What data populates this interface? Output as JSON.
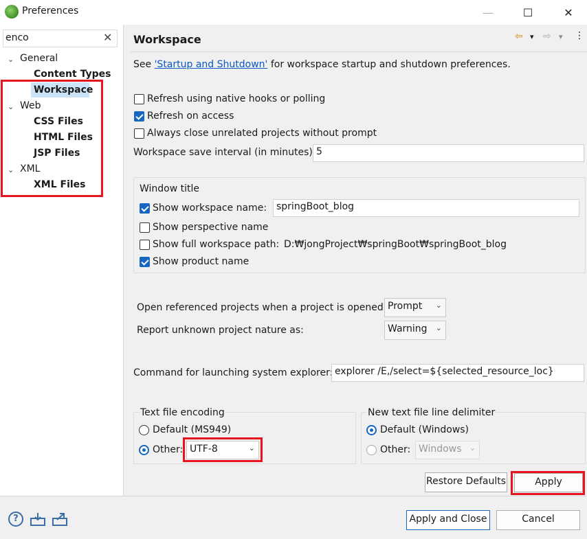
{
  "window": {
    "title": "Preferences",
    "minimize": "—",
    "maximize": "☐",
    "close": "✕"
  },
  "filter": {
    "value": "enco",
    "clear": "✕"
  },
  "tree": [
    {
      "label": "General",
      "chev": "⌄"
    },
    {
      "label": "Content Types"
    },
    {
      "label": "Workspace"
    },
    {
      "label": "Web",
      "chev": "⌄"
    },
    {
      "label": "CSS Files"
    },
    {
      "label": "HTML Files"
    },
    {
      "label": "JSP Files"
    },
    {
      "label": "XML",
      "chev": "⌄"
    },
    {
      "label": "XML Files"
    }
  ],
  "page": {
    "title": "Workspace",
    "nav": {
      "back": "⇦",
      "back_menu": "▾",
      "forward": "⇨",
      "forward_menu": "▾",
      "more": "⋮"
    },
    "intro_prefix": "See ",
    "intro_link": "'Startup and Shutdown'",
    "intro_suffix": " for workspace startup and shutdown preferences.",
    "checkboxes": [
      {
        "label": "Refresh using native hooks or polling",
        "checked": false
      },
      {
        "label": "Refresh on access",
        "checked": true
      },
      {
        "label": "Always close unrelated projects without prompt",
        "checked": false
      }
    ],
    "save_interval": {
      "label": "Workspace save interval (in minutes):",
      "value": "5"
    },
    "window_title": {
      "legend": "Window title",
      "show_workspace_name": {
        "label": "Show workspace name:",
        "checked": true,
        "value": "springBoot_blog"
      },
      "show_perspective_name": {
        "label": "Show perspective name",
        "checked": false
      },
      "show_full_path": {
        "label": "Show full workspace path:",
        "checked": false,
        "value": "D:₩jongProject₩springBoot₩springBoot_blog"
      },
      "show_product_name": {
        "label": "Show product name",
        "checked": true
      }
    },
    "open_referenced": {
      "label": "Open referenced projects when a project is opened:",
      "value": "Prompt"
    },
    "report_unknown": {
      "label": "Report unknown project nature as:",
      "value": "Warning"
    },
    "command": {
      "label": "Command for launching system explorer:",
      "value": "explorer /E,/select=${selected_resource_loc}"
    },
    "encoding": {
      "legend": "Text file encoding",
      "default_label": "Default (MS949)",
      "other_label": "Other:",
      "other_value": "UTF-8",
      "selected": "other"
    },
    "delimiter": {
      "legend": "New text file line delimiter",
      "default_label": "Default (Windows)",
      "other_label": "Other:",
      "other_value": "Windows",
      "selected": "default"
    },
    "restore_defaults": "Restore Defaults",
    "apply": "Apply"
  },
  "footer": {
    "help_icon": "?",
    "apply_and_close": "Apply and Close",
    "cancel": "Cancel"
  },
  "colors": {
    "accent": "#1766c0",
    "highlight_box": "#e5141f",
    "selection": "#cce4f7",
    "link": "#0a58c2"
  },
  "combo_arrow": "⌄"
}
